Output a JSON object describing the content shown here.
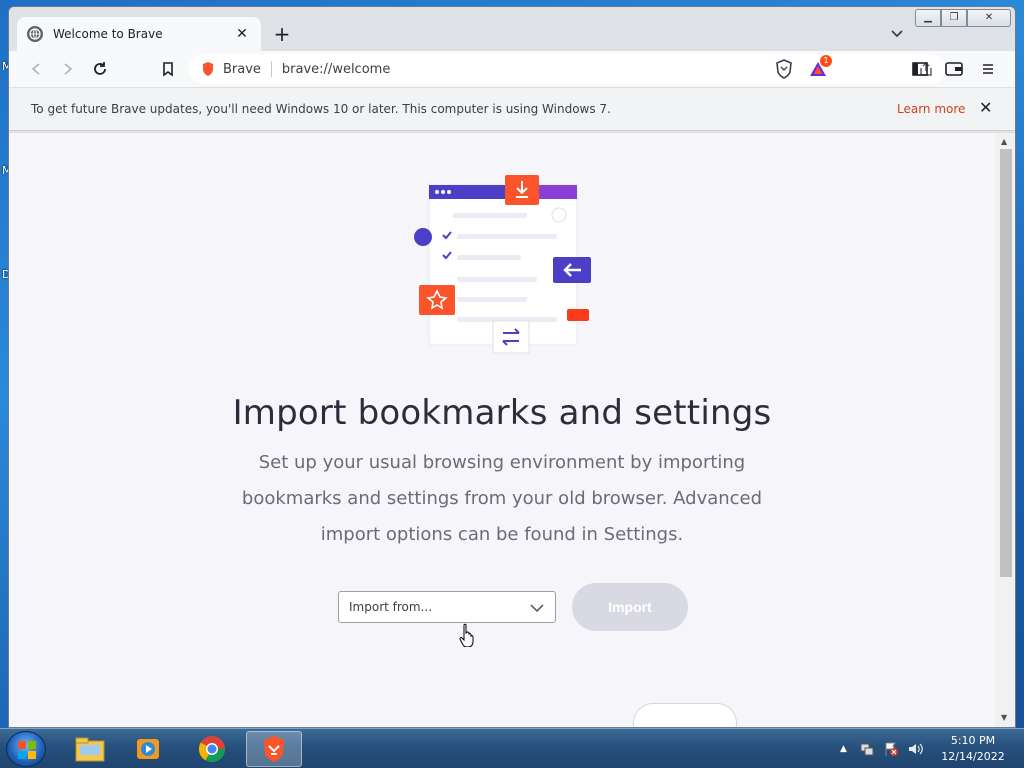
{
  "desktop": {
    "letters": [
      "M",
      "M",
      "D"
    ]
  },
  "browser": {
    "tab": {
      "title": "Welcome to Brave",
      "close": "✕"
    },
    "new_tab": "+",
    "omnibox": {
      "brand": "Brave",
      "url": "brave://welcome"
    },
    "shields_badge": "1",
    "infobar": {
      "message": "To get future Brave updates, you'll need Windows 10 or later. This computer is using Windows 7.",
      "learn_more": "Learn more",
      "close": "✕"
    }
  },
  "page": {
    "heading": "Import bookmarks and settings",
    "description": "Set up your usual browsing environment by importing bookmarks and settings from your old browser. Advanced import options can be found in Settings.",
    "import_select": {
      "value": "Import from..."
    },
    "import_button": "Import"
  },
  "taskbar": {
    "apps": [
      "windows-explorer",
      "media-player",
      "chrome",
      "brave"
    ],
    "clock": {
      "time": "5:10 PM",
      "date": "12/14/2022"
    }
  },
  "colors": {
    "brave_orange": "#fb542b",
    "accent_purple": "#4c3fc7",
    "button_disabled": "#d8d9e2",
    "learn_more": "#d0421b"
  }
}
